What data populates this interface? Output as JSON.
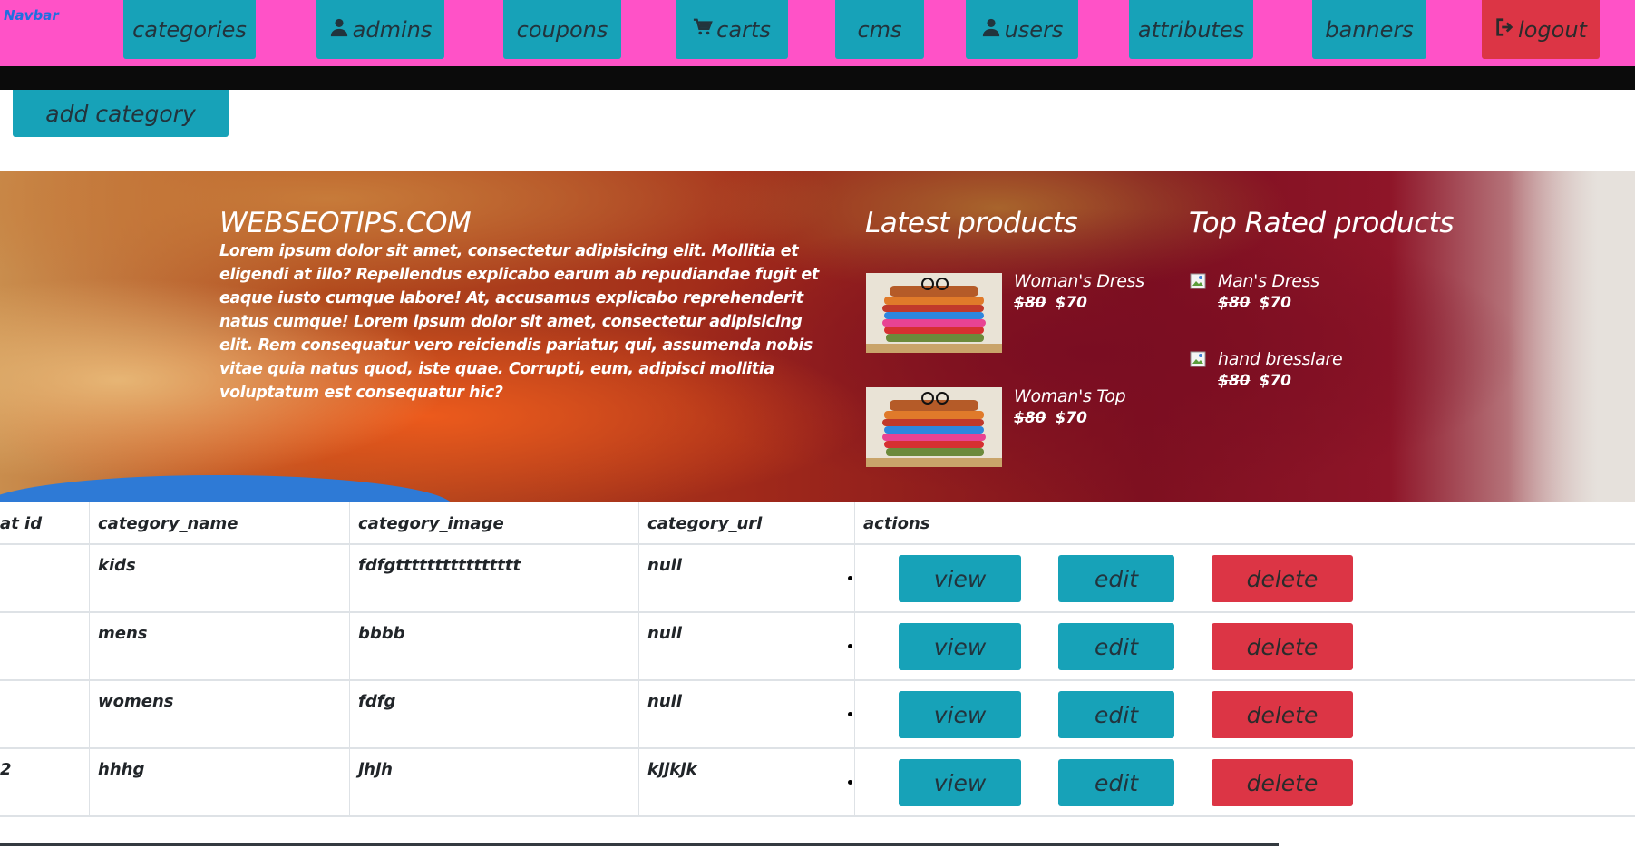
{
  "navbar": {
    "brand": "Navbar",
    "items": [
      {
        "label": "categories",
        "icon": ""
      },
      {
        "label": "admins",
        "icon": "user-icon"
      },
      {
        "label": "coupons",
        "icon": ""
      },
      {
        "label": "carts",
        "icon": "cart-icon"
      },
      {
        "label": "cms",
        "icon": ""
      },
      {
        "label": "users",
        "icon": "user-icon"
      },
      {
        "label": "attributes",
        "icon": ""
      },
      {
        "label": "banners",
        "icon": ""
      },
      {
        "label": "logout",
        "icon": "logout-icon"
      }
    ]
  },
  "toolbar": {
    "add_label": "add category"
  },
  "hero": {
    "title": "WEBSEOTIPS.COM",
    "text": "Lorem ipsum dolor sit amet, consectetur adipisicing elit. Mollitia et eligendi at illo? Repellendus explicabo earum ab repudiandae fugit et eaque iusto cumque labore! At, accusamus explicabo reprehenderit natus cumque! Lorem ipsum dolor sit amet, consectetur adipisicing elit. Rem consequatur vero reiciendis pariatur, qui, assumenda nobis vitae quia natus quod, iste quae. Corrupti, eum, adipisci mollitia voluptatum est consequatur hic?",
    "latest": {
      "title": "Latest products",
      "items": [
        {
          "name": "Woman's Dress",
          "old_price": "$80",
          "price": "$70"
        },
        {
          "name": "Woman's Top",
          "old_price": "$80",
          "price": "$70"
        }
      ]
    },
    "top_rated": {
      "title": "Top Rated products",
      "items": [
        {
          "name": "Man's Dress",
          "old_price": "$80",
          "price": "$70"
        },
        {
          "name": "hand bresslare",
          "old_price": "$80",
          "price": "$70"
        }
      ]
    }
  },
  "table": {
    "columns": [
      "at id",
      "category_name",
      "category_image",
      "category_url",
      "actions"
    ],
    "rows": [
      {
        "id": "",
        "name": "kids",
        "image": "fdfgtttttttttttttttt",
        "url": "null"
      },
      {
        "id": "",
        "name": "mens",
        "image": "bbbb",
        "url": "null"
      },
      {
        "id": "",
        "name": "womens",
        "image": "fdfg",
        "url": "null"
      },
      {
        "id": "2",
        "name": "hhhg",
        "image": "jhjh",
        "url": "kjjkjk"
      }
    ],
    "actions": {
      "view": "view",
      "edit": "edit",
      "delete": "delete"
    }
  },
  "colors": {
    "navbar_bg": "#ff52c7",
    "primary": "#17a2b8",
    "danger": "#dc3545",
    "brand_text": "#1f6fe0"
  }
}
